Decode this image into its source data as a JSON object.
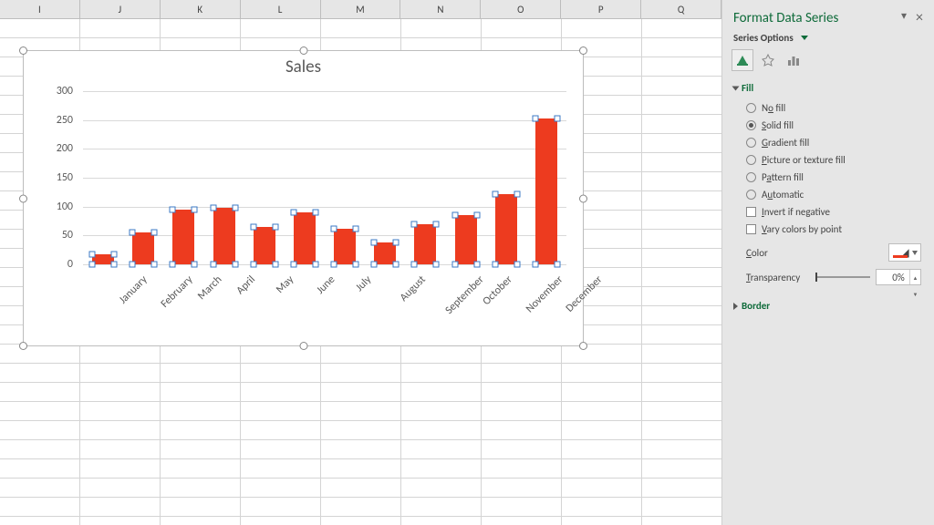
{
  "grid_columns": [
    "I",
    "J",
    "K",
    "L",
    "M",
    "N",
    "O",
    "P",
    "Q"
  ],
  "chart_data": {
    "type": "bar",
    "title": "Sales",
    "categories": [
      "January",
      "February",
      "March",
      "April",
      "May",
      "June",
      "July",
      "August",
      "September",
      "October",
      "November",
      "December"
    ],
    "values": [
      18,
      55,
      95,
      98,
      65,
      90,
      62,
      38,
      70,
      85,
      122,
      252
    ],
    "y_ticks": [
      0,
      50,
      100,
      150,
      200,
      250,
      300
    ],
    "ylim": [
      0,
      300
    ],
    "xlabel": "",
    "ylabel": "",
    "bar_color": "#ed3b1f"
  },
  "pane": {
    "title": "Format Data Series",
    "subtitle": "Series Options",
    "sections": {
      "fill": {
        "header": "Fill",
        "options": {
          "no_fill": {
            "label_pre": "N",
            "label_u": "o",
            "label_post": " fill"
          },
          "solid": {
            "label_pre": "",
            "label_u": "S",
            "label_post": "olid fill"
          },
          "gradient": {
            "label_pre": "",
            "label_u": "G",
            "label_post": "radient fill"
          },
          "picture": {
            "label_pre": "",
            "label_u": "P",
            "label_post": "icture or texture fill"
          },
          "pattern": {
            "label_pre": "P",
            "label_u": "a",
            "label_post": "ttern fill"
          },
          "automatic": {
            "label_pre": "A",
            "label_u": "u",
            "label_post": "tomatic"
          }
        },
        "selected": "solid",
        "invert_if_negative": {
          "label_pre": "",
          "label_u": "I",
          "label_post": "nvert if negative",
          "checked": false
        },
        "vary_colors": {
          "label_pre": "",
          "label_u": "V",
          "label_post": "ary colors by point",
          "checked": false
        },
        "color_label_pre": "",
        "color_label_u": "C",
        "color_label_post": "olor",
        "color_value": "#ed3b1f",
        "transparency_label_pre": "",
        "transparency_label_u": "T",
        "transparency_label_post": "ransparency",
        "transparency_value": "0%"
      },
      "border": {
        "header": "Border"
      }
    }
  }
}
